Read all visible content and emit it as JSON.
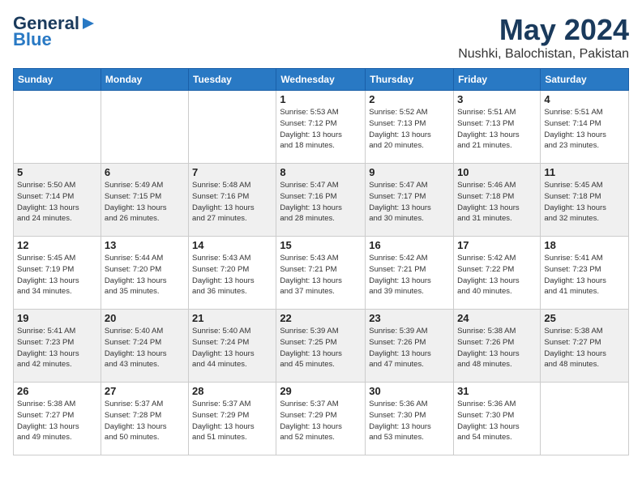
{
  "header": {
    "logo_line1": "General",
    "logo_line2": "Blue",
    "month": "May 2024",
    "location": "Nushki, Balochistan, Pakistan"
  },
  "weekdays": [
    "Sunday",
    "Monday",
    "Tuesday",
    "Wednesday",
    "Thursday",
    "Friday",
    "Saturday"
  ],
  "weeks": [
    [
      {
        "day": "",
        "info": ""
      },
      {
        "day": "",
        "info": ""
      },
      {
        "day": "",
        "info": ""
      },
      {
        "day": "1",
        "info": "Sunrise: 5:53 AM\nSunset: 7:12 PM\nDaylight: 13 hours\nand 18 minutes."
      },
      {
        "day": "2",
        "info": "Sunrise: 5:52 AM\nSunset: 7:13 PM\nDaylight: 13 hours\nand 20 minutes."
      },
      {
        "day": "3",
        "info": "Sunrise: 5:51 AM\nSunset: 7:13 PM\nDaylight: 13 hours\nand 21 minutes."
      },
      {
        "day": "4",
        "info": "Sunrise: 5:51 AM\nSunset: 7:14 PM\nDaylight: 13 hours\nand 23 minutes."
      }
    ],
    [
      {
        "day": "5",
        "info": "Sunrise: 5:50 AM\nSunset: 7:14 PM\nDaylight: 13 hours\nand 24 minutes."
      },
      {
        "day": "6",
        "info": "Sunrise: 5:49 AM\nSunset: 7:15 PM\nDaylight: 13 hours\nand 26 minutes."
      },
      {
        "day": "7",
        "info": "Sunrise: 5:48 AM\nSunset: 7:16 PM\nDaylight: 13 hours\nand 27 minutes."
      },
      {
        "day": "8",
        "info": "Sunrise: 5:47 AM\nSunset: 7:16 PM\nDaylight: 13 hours\nand 28 minutes."
      },
      {
        "day": "9",
        "info": "Sunrise: 5:47 AM\nSunset: 7:17 PM\nDaylight: 13 hours\nand 30 minutes."
      },
      {
        "day": "10",
        "info": "Sunrise: 5:46 AM\nSunset: 7:18 PM\nDaylight: 13 hours\nand 31 minutes."
      },
      {
        "day": "11",
        "info": "Sunrise: 5:45 AM\nSunset: 7:18 PM\nDaylight: 13 hours\nand 32 minutes."
      }
    ],
    [
      {
        "day": "12",
        "info": "Sunrise: 5:45 AM\nSunset: 7:19 PM\nDaylight: 13 hours\nand 34 minutes."
      },
      {
        "day": "13",
        "info": "Sunrise: 5:44 AM\nSunset: 7:20 PM\nDaylight: 13 hours\nand 35 minutes."
      },
      {
        "day": "14",
        "info": "Sunrise: 5:43 AM\nSunset: 7:20 PM\nDaylight: 13 hours\nand 36 minutes."
      },
      {
        "day": "15",
        "info": "Sunrise: 5:43 AM\nSunset: 7:21 PM\nDaylight: 13 hours\nand 37 minutes."
      },
      {
        "day": "16",
        "info": "Sunrise: 5:42 AM\nSunset: 7:21 PM\nDaylight: 13 hours\nand 39 minutes."
      },
      {
        "day": "17",
        "info": "Sunrise: 5:42 AM\nSunset: 7:22 PM\nDaylight: 13 hours\nand 40 minutes."
      },
      {
        "day": "18",
        "info": "Sunrise: 5:41 AM\nSunset: 7:23 PM\nDaylight: 13 hours\nand 41 minutes."
      }
    ],
    [
      {
        "day": "19",
        "info": "Sunrise: 5:41 AM\nSunset: 7:23 PM\nDaylight: 13 hours\nand 42 minutes."
      },
      {
        "day": "20",
        "info": "Sunrise: 5:40 AM\nSunset: 7:24 PM\nDaylight: 13 hours\nand 43 minutes."
      },
      {
        "day": "21",
        "info": "Sunrise: 5:40 AM\nSunset: 7:24 PM\nDaylight: 13 hours\nand 44 minutes."
      },
      {
        "day": "22",
        "info": "Sunrise: 5:39 AM\nSunset: 7:25 PM\nDaylight: 13 hours\nand 45 minutes."
      },
      {
        "day": "23",
        "info": "Sunrise: 5:39 AM\nSunset: 7:26 PM\nDaylight: 13 hours\nand 47 minutes."
      },
      {
        "day": "24",
        "info": "Sunrise: 5:38 AM\nSunset: 7:26 PM\nDaylight: 13 hours\nand 48 minutes."
      },
      {
        "day": "25",
        "info": "Sunrise: 5:38 AM\nSunset: 7:27 PM\nDaylight: 13 hours\nand 48 minutes."
      }
    ],
    [
      {
        "day": "26",
        "info": "Sunrise: 5:38 AM\nSunset: 7:27 PM\nDaylight: 13 hours\nand 49 minutes."
      },
      {
        "day": "27",
        "info": "Sunrise: 5:37 AM\nSunset: 7:28 PM\nDaylight: 13 hours\nand 50 minutes."
      },
      {
        "day": "28",
        "info": "Sunrise: 5:37 AM\nSunset: 7:29 PM\nDaylight: 13 hours\nand 51 minutes."
      },
      {
        "day": "29",
        "info": "Sunrise: 5:37 AM\nSunset: 7:29 PM\nDaylight: 13 hours\nand 52 minutes."
      },
      {
        "day": "30",
        "info": "Sunrise: 5:36 AM\nSunset: 7:30 PM\nDaylight: 13 hours\nand 53 minutes."
      },
      {
        "day": "31",
        "info": "Sunrise: 5:36 AM\nSunset: 7:30 PM\nDaylight: 13 hours\nand 54 minutes."
      },
      {
        "day": "",
        "info": ""
      }
    ]
  ]
}
